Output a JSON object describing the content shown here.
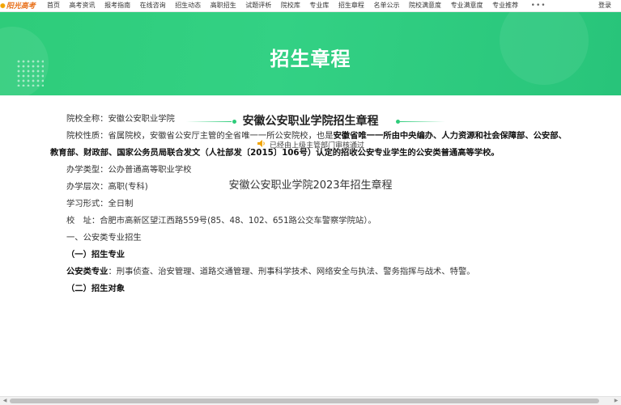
{
  "topnav": {
    "logo_text": "阳光高考",
    "items": [
      "首页",
      "高考资讯",
      "报考指南",
      "在线咨询",
      "招生动态",
      "高职招生",
      "试题评析",
      "院校库",
      "专业库",
      "招生章程",
      "名单公示",
      "院校满意度",
      "专业满意度",
      "专业推荐"
    ],
    "more": "•••",
    "login": "登录"
  },
  "banner": {
    "title": "招生章程"
  },
  "heading": {
    "title": "安徽公安职业学院招生章程",
    "notice": "已经由上级主管部门审核通过"
  },
  "doc": {
    "title": "安徽公安职业学院2023年招生章程",
    "full_name_label": "院校全称：",
    "full_name": "安徽公安职业学院",
    "nature_label": "院校性质：",
    "nature_text": "省属院校，安徽省公安厅主管的全省唯一一所公安院校，也是",
    "nature_bold_1": "安徽省唯一一所由中央编办、人力资源和社会保障部、公安部、",
    "nature_bold_2": "教育部、财政部、国家公务员局联合发文（人社部发〔2015〕106号）认定的招收公安专业学生的公安类普通高等学校。",
    "type_label": "办学类型：",
    "type": "公办普通高等职业学校",
    "level_label": "办学层次：",
    "level": "高职(专科)",
    "form_label": "学习形式：",
    "form": "全日制",
    "address_label": "校　址：",
    "address": "合肥市高新区望江西路559号(85、48、102、651路公交车警察学院站）。",
    "section1": "一、公安类专业招生",
    "sub1": "（一）招生专业",
    "majors_label": "公安类专业",
    "majors": "：刑事侦查、治安管理、道路交通管理、刑事科学技术、网络安全与执法、警务指挥与战术、特警。",
    "sub2": "（二）招生对象"
  }
}
